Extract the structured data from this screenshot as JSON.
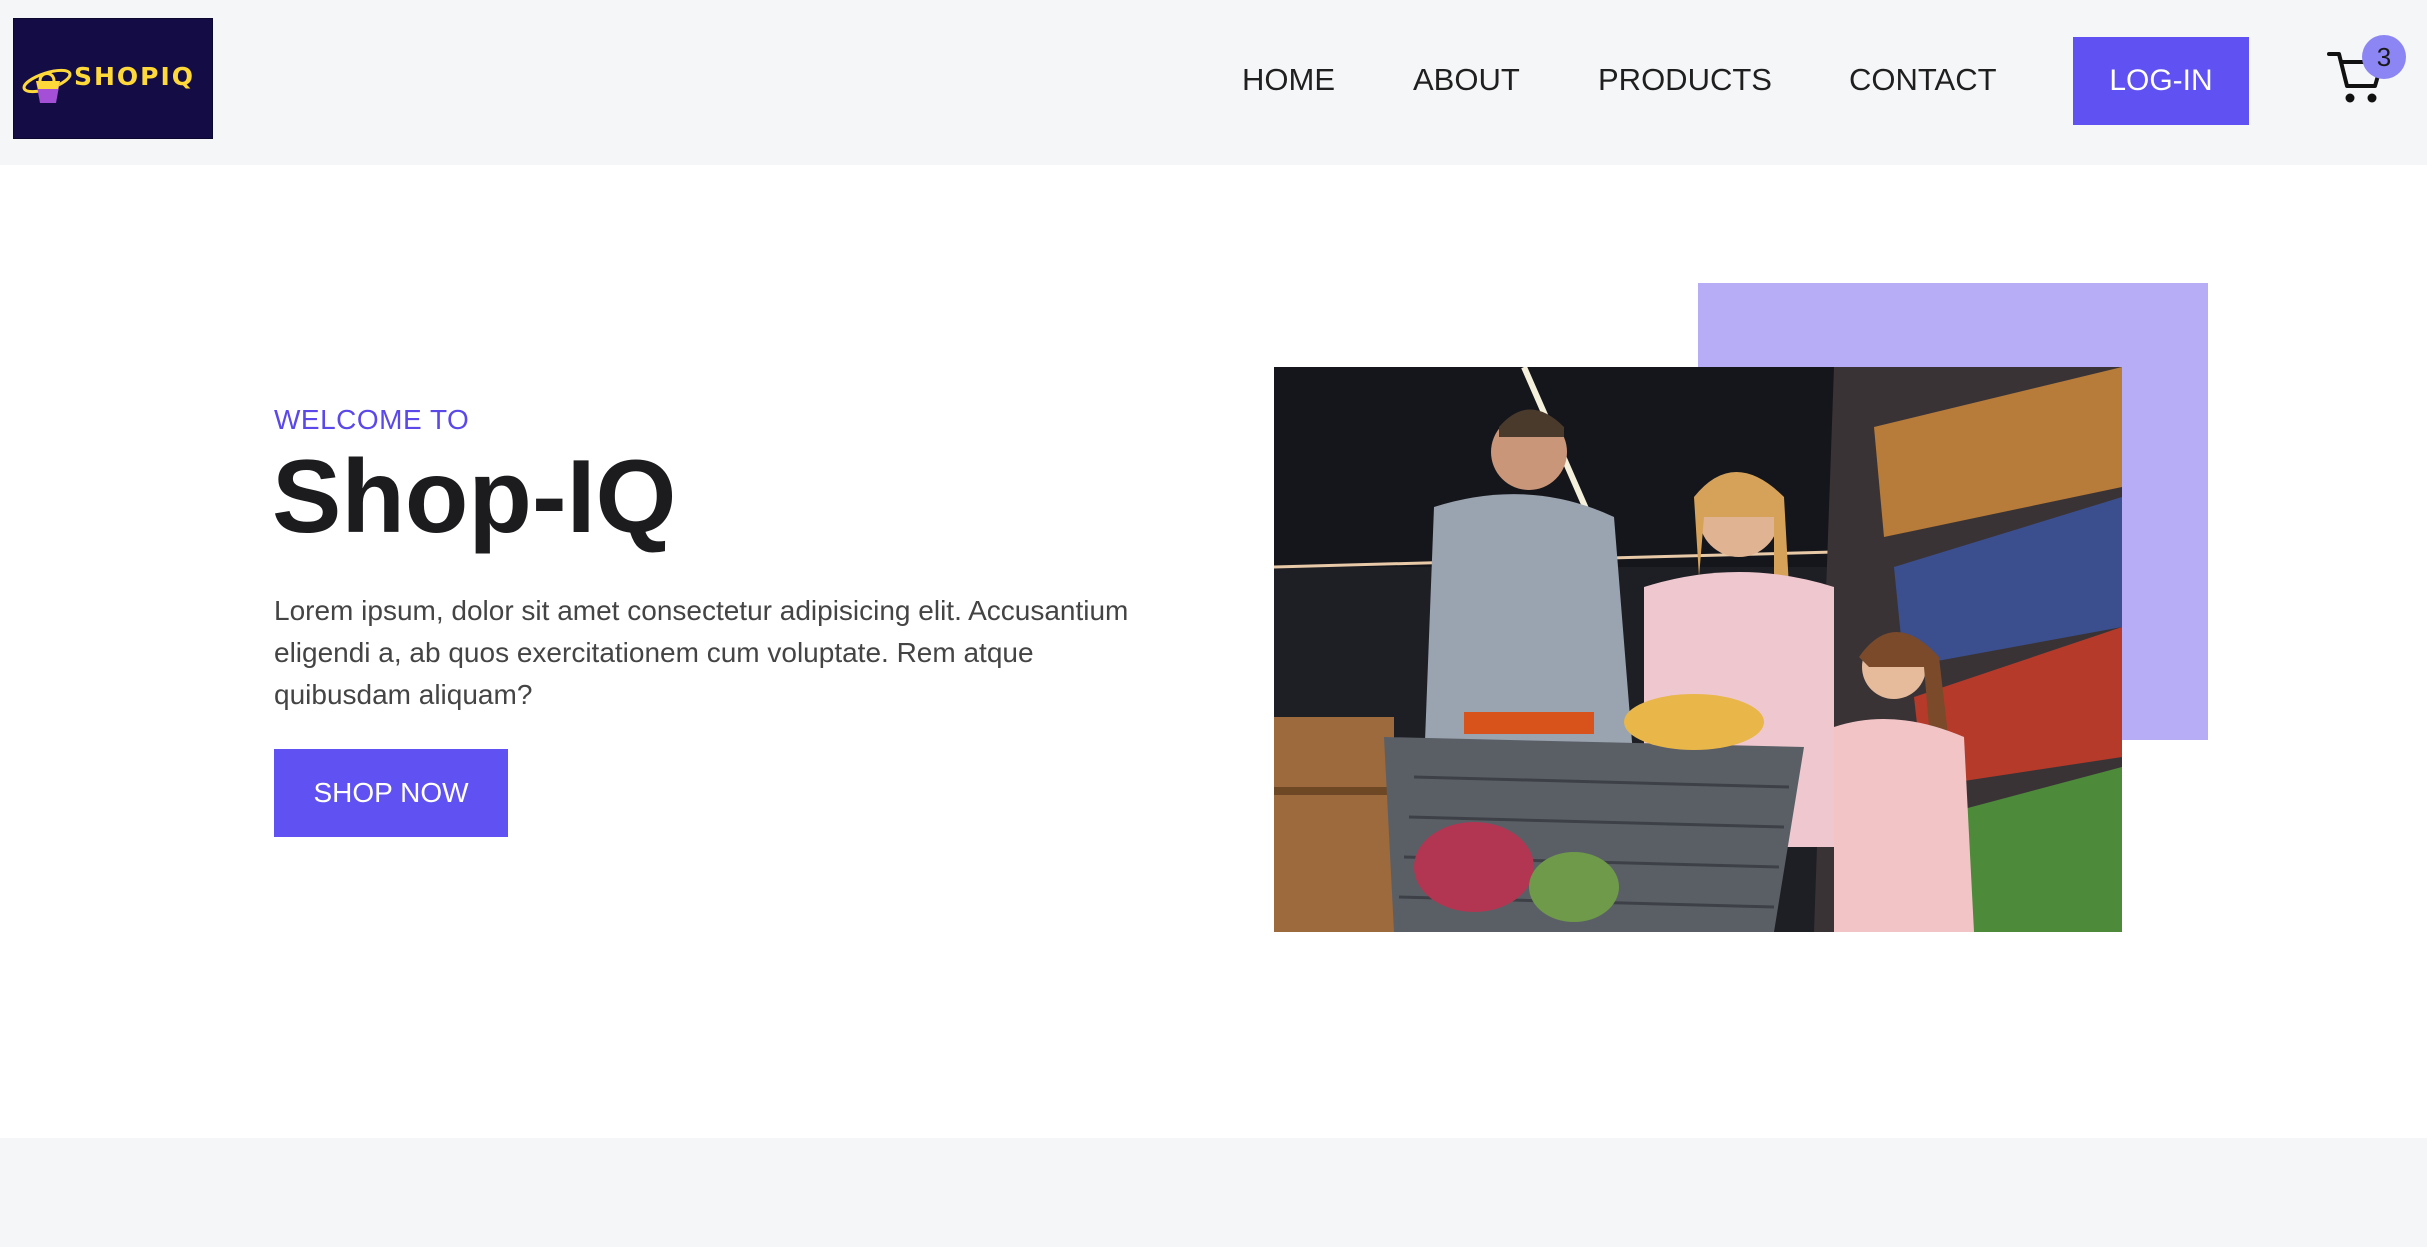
{
  "brand": {
    "logo_text": "SHOPIQ",
    "colors": {
      "primary": "#6052f2",
      "accent_text": "#5b48e8",
      "accent_block": "#b6adf6",
      "logo_bg": "#140d45",
      "logo_text": "#ffd93a",
      "header_bg": "#f5f6f8"
    }
  },
  "nav": {
    "items": [
      {
        "label": "HOME"
      },
      {
        "label": "ABOUT"
      },
      {
        "label": "PRODUCTS"
      },
      {
        "label": "CONTACT"
      }
    ],
    "login_label": "LOG-IN",
    "cart_icon": "shopping-cart-icon",
    "cart_count": "3"
  },
  "hero": {
    "eyebrow": "WELCOME TO",
    "title": "Shop-IQ",
    "description": "Lorem ipsum, dolor sit amet consectetur adipisicing elit. Accusantium eligendi a, ab quos exercitationem cum voluptate. Rem atque quibusdam aliquam?",
    "cta_label": "SHOP NOW",
    "image_icon": "family-shopping-photo"
  }
}
